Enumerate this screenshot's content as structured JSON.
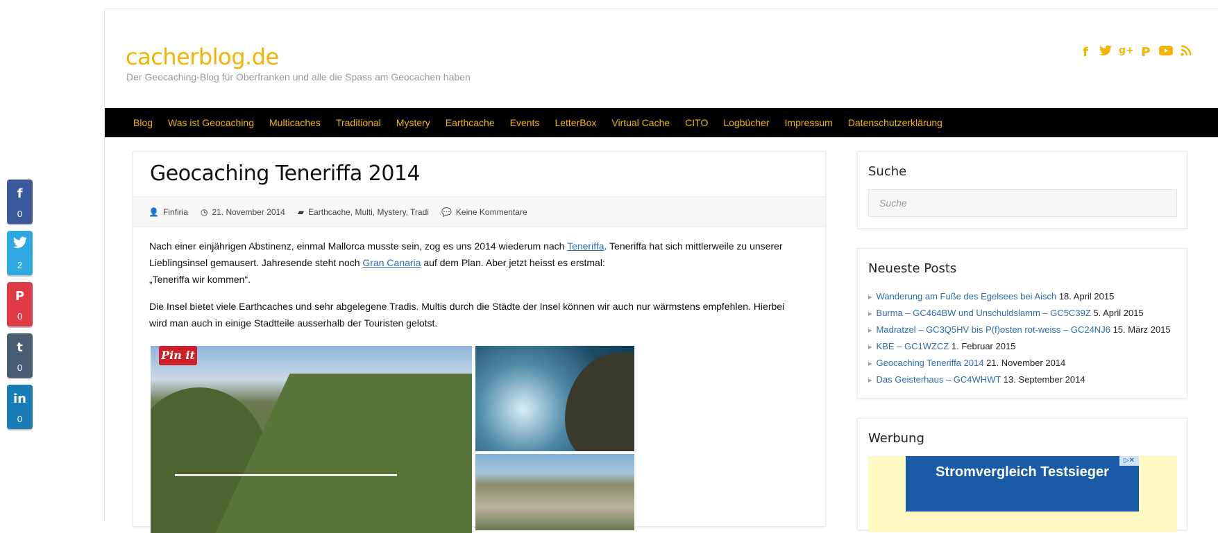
{
  "share": [
    {
      "network": "facebook",
      "icon": "f",
      "count": "0",
      "color": "#3b5998"
    },
    {
      "network": "twitter",
      "icon": "🐦",
      "count": "2",
      "color": "#2fa9e1"
    },
    {
      "network": "pinterest",
      "icon": "P",
      "count": "0",
      "color": "#e03a46"
    },
    {
      "network": "tumblr",
      "icon": "t",
      "count": "0",
      "color": "#4a5c72"
    },
    {
      "network": "linkedin",
      "icon": "in",
      "count": "0",
      "color": "#1a7db8"
    }
  ],
  "header": {
    "title": "cacherblog.de",
    "description": "Der Geocaching-Blog für Oberfranken und alle die Spass am Geocachen haben",
    "accent": "#f2b400",
    "social_icons": [
      "facebook-icon",
      "twitter-icon",
      "google-plus-icon",
      "pinterest-icon",
      "youtube-icon",
      "rss-icon"
    ]
  },
  "nav": [
    "Blog",
    "Was ist Geocaching",
    "Multicaches",
    "Traditional",
    "Mystery",
    "Earthcache",
    "Events",
    "LetterBox",
    "Virtual Cache",
    "CITO",
    "Logbücher",
    "Impressum",
    "Datenschutzerklärung"
  ],
  "article": {
    "title": "Geocaching Teneriffa 2014",
    "author": "Finfiria",
    "date": "21. November 2014",
    "categories": "Earthcache, Multi, Mystery, Tradi",
    "comments": "Keine Kommentare",
    "p1_a": "Nach einer einjährigen Abstinenz, einmal Mallorca musste sein, zog es uns 2014 wiederum nach ",
    "p1_link1": "Teneriffa",
    "p1_b": ". Teneriffa hat sich mittlerweile zu unserer Lieblingsinsel gemausert. Jahresende steht noch ",
    "p1_link2": "Gran Canaria",
    "p1_c": " auf dem Plan. Aber jetzt heisst es erstmal:",
    "p1_d": "„Teneriffa wir kommen“.",
    "p2": "Die Insel bietet viele Earthcaches und sehr abgelegene Tradis. Multis durch die Städte der Insel können wir auch nur wärmstens empfehlen. Hierbei wird man auch in einige Stadtteile ausserhalb der Touristen gelotst.",
    "pinit": "Pin it"
  },
  "sidebar": {
    "search_title": "Suche",
    "search_placeholder": "Suche",
    "posts_title": "Neueste Posts",
    "posts": [
      {
        "title": "Wanderung am Fuße des Egelsees bei Aisch",
        "date": "18. April 2015"
      },
      {
        "title": "Burma – GC464BW und Unschuldslamm – GC5C39Z",
        "date": "5. April 2015"
      },
      {
        "title": "Madratzel – GC3Q5HV bis P(f)osten rot-weiss – GC24NJ6",
        "date": "15. März 2015"
      },
      {
        "title": "KBE – GC1WZCZ",
        "date": "1. Februar 2015"
      },
      {
        "title": "Geocaching Teneriffa 2014",
        "date": "21. November 2014"
      },
      {
        "title": "Das Geisterhaus – GC4WHWT",
        "date": "13. September 2014"
      }
    ],
    "ad_title": "Werbung",
    "ad_text": "Stromvergleich Testsieger"
  }
}
